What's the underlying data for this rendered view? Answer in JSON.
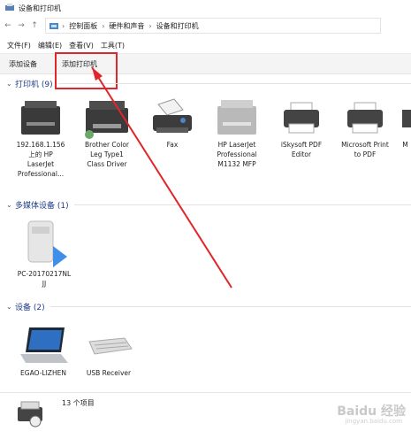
{
  "window": {
    "title": "设备和打印机"
  },
  "address": {
    "back": "←",
    "forward": "→",
    "up": "↑",
    "crumbs": [
      "控制面板",
      "硬件和声音",
      "设备和打印机"
    ],
    "sep": "›"
  },
  "menu": [
    "文件(F)",
    "编辑(E)",
    "查看(V)",
    "工具(T)"
  ],
  "commands": {
    "add_device": "添加设备",
    "add_printer": "添加打印机"
  },
  "groups": {
    "printers": {
      "title": "打印机 (9)"
    },
    "media": {
      "title": "多媒体设备 (1)"
    },
    "devices": {
      "title": "设备 (2)"
    }
  },
  "printers": [
    {
      "l1": "192.168.1.156",
      "l2": "上的 HP",
      "l3": "LaserJet",
      "l4": "Professional..."
    },
    {
      "l1": "Brother Color",
      "l2": "Leg Type1",
      "l3": "Class Driver",
      "l4": ""
    },
    {
      "l1": "Fax",
      "l2": "",
      "l3": "",
      "l4": ""
    },
    {
      "l1": "HP LaserJet",
      "l2": "Professional",
      "l3": "M1132 MFP",
      "l4": ""
    },
    {
      "l1": "iSkysoft PDF",
      "l2": "Editor",
      "l3": "",
      "l4": ""
    },
    {
      "l1": "Microsoft Print",
      "l2": "to PDF",
      "l3": "",
      "l4": ""
    },
    {
      "l1": "M",
      "l2": "",
      "l3": "",
      "l4": ""
    }
  ],
  "media": [
    {
      "l1": "PC-20170217NL",
      "l2": "JJ"
    }
  ],
  "devices": [
    {
      "l1": "EGAO-LIZHEN"
    },
    {
      "l1": "USB Receiver"
    }
  ],
  "status": {
    "count": "13 个项目"
  },
  "watermark": {
    "main": "Baidu 经验",
    "sub": "jingyan.baidu.com"
  },
  "colors": {
    "highlight": "#e0262a",
    "group_title": "#1f3d8a"
  }
}
